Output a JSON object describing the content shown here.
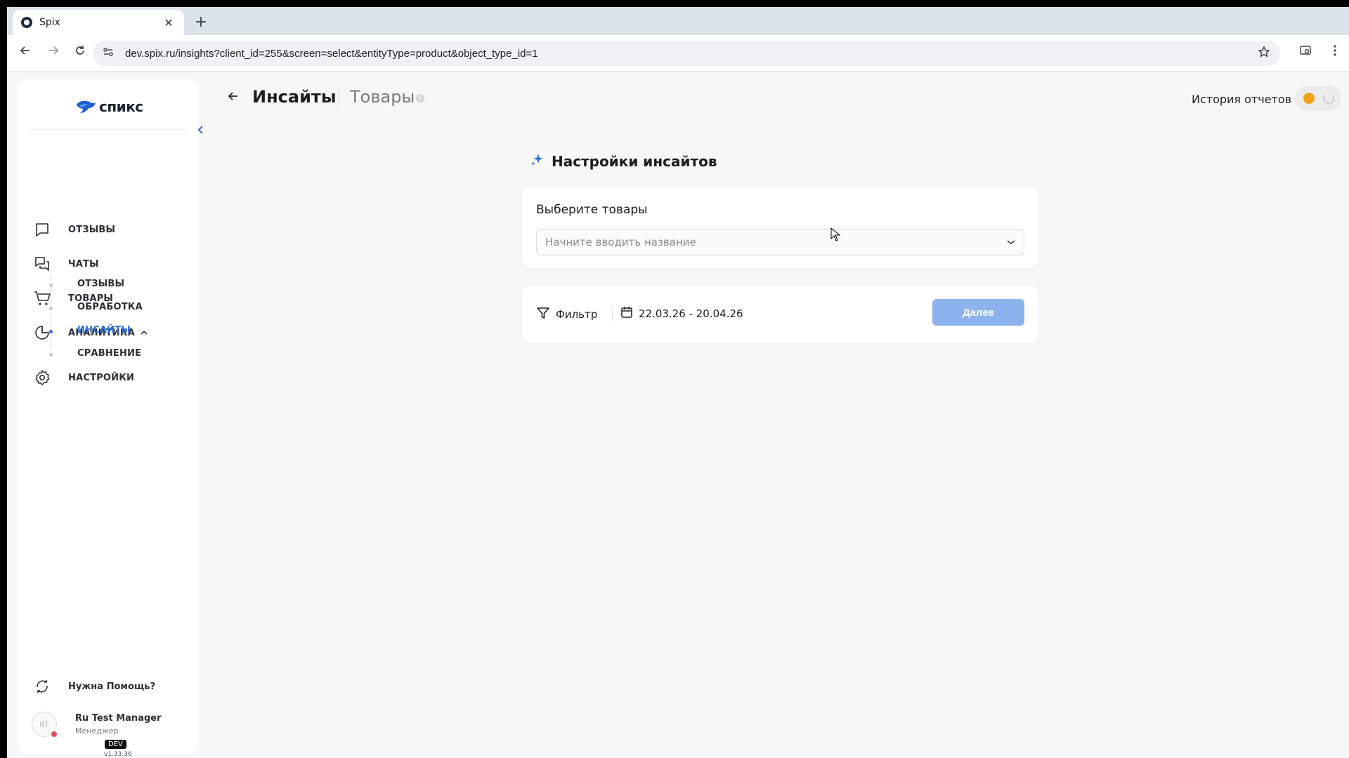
{
  "browser": {
    "tab_title": "Spix",
    "tab_close": "✕",
    "new_tab": "+",
    "url": "dev.spix.ru/insights?client_id=255&screen=select&entityType=product&object_type_id=1"
  },
  "sidebar": {
    "logo_text": "спикс",
    "items": [
      {
        "label": "ОТЗЫВЫ",
        "icon": "message-square-icon"
      },
      {
        "label": "ЧАТЫ",
        "icon": "chats-icon"
      },
      {
        "label": "ТОВАРЫ",
        "icon": "shopping-cart-icon"
      },
      {
        "label": "АНАЛИТИКА",
        "icon": "pie-chart-icon"
      },
      {
        "label": "НАСТРОЙКИ",
        "icon": "gear-icon"
      }
    ],
    "analytics_sub": [
      {
        "label": "ОТЗЫВЫ",
        "active": false
      },
      {
        "label": "ОБРАБОТКА",
        "active": false
      },
      {
        "label": "ИНСАЙТЫ",
        "active": true
      },
      {
        "label": "СРАВНЕНИЕ",
        "active": false
      }
    ],
    "help_label": "Нужна Помощь?",
    "user": {
      "initials": "RT",
      "name": "Ru Test Manager",
      "role": "Менеджер"
    },
    "env_badge": "DEV",
    "version": "v1.33.36"
  },
  "header": {
    "title": "Инсайты",
    "subtitle": "Товары",
    "history_label": "История отчетов"
  },
  "settings": {
    "title": "Настройки инсайтов",
    "select_label": "Выберите товары",
    "select_placeholder": "Начните вводить название",
    "filter_label": "Фильтр",
    "date_range": "22.03.26 - 20.04.26",
    "next_label": "Далее"
  },
  "colors": {
    "accent": "#2d6fd8",
    "next_button": "#8db3ef",
    "toggle_dot": "#f2a316"
  }
}
